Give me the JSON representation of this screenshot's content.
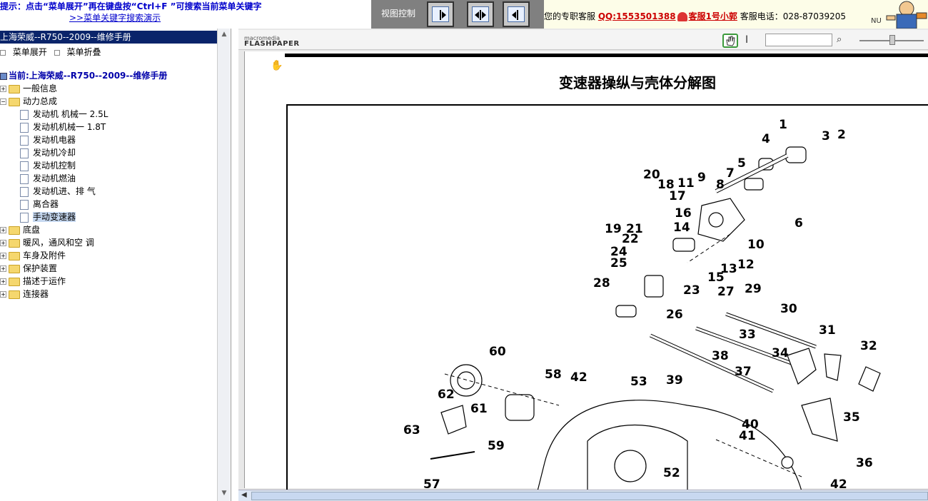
{
  "banner": {
    "hint_line1": "提示：点击“菜单展开”再在键盘按“Ctrl+F ”可搜索当前菜单关键字",
    "hint_line2": ">>菜单关键字搜索演示",
    "view_control_label": "视图控制",
    "support_prefix": "您的专职客服",
    "qq": "QQ:1553501388",
    "kefu": "客服1号小郭",
    "phone_label": "客服电话：028-87039205",
    "nu": "NU"
  },
  "sidebar": {
    "title": "上海荣威--R750--2009--维修手册",
    "expand_label": "菜单展开",
    "collapse_label": "菜单折叠",
    "current_label": "当前:上海荣威--R750--2009--维修手册",
    "items": [
      {
        "label": "一般信息",
        "type": "folder",
        "expanded": false
      },
      {
        "label": "动力总成",
        "type": "folder",
        "expanded": true
      },
      {
        "label": "发动机 机械一 2.5L",
        "type": "doc"
      },
      {
        "label": "发动机机械一 1.8T",
        "type": "doc"
      },
      {
        "label": "发动机电器",
        "type": "doc"
      },
      {
        "label": "发动机冷却",
        "type": "doc"
      },
      {
        "label": "发动机控制",
        "type": "doc"
      },
      {
        "label": "发动机燃油",
        "type": "doc"
      },
      {
        "label": "发动机进、排 气",
        "type": "doc"
      },
      {
        "label": "离合器",
        "type": "doc"
      },
      {
        "label": "手动变速器",
        "type": "doc",
        "selected": true
      },
      {
        "label": "底盘",
        "type": "folder",
        "expanded": false
      },
      {
        "label": "暖风，通风和空 调",
        "type": "folder",
        "expanded": false
      },
      {
        "label": "车身及附件",
        "type": "folder",
        "expanded": false
      },
      {
        "label": "保护装置",
        "type": "folder",
        "expanded": false
      },
      {
        "label": "描述于运作",
        "type": "folder",
        "expanded": false
      },
      {
        "label": "连接器",
        "type": "folder",
        "expanded": false
      }
    ]
  },
  "viewer": {
    "logo_top": "macromedia",
    "logo_bottom": "FLASHPAPER",
    "search_value": "",
    "page_title": "变速器操纵与壳体分解图",
    "callouts": [
      "1",
      "2",
      "3",
      "4",
      "5",
      "6",
      "7",
      "8",
      "9",
      "10",
      "11",
      "12",
      "13",
      "14",
      "15",
      "16",
      "17",
      "18",
      "19",
      "20",
      "21",
      "22",
      "23",
      "24",
      "25",
      "26",
      "27",
      "28",
      "29",
      "30",
      "31",
      "32",
      "33",
      "34",
      "35",
      "36",
      "37",
      "38",
      "39",
      "40",
      "41",
      "42",
      "52",
      "53",
      "57",
      "58",
      "59",
      "60",
      "61",
      "62",
      "63"
    ]
  },
  "colors": {
    "sidebar_title_bg": "#0a246a",
    "hint_text": "#0000cc",
    "view_panel_bg": "#808080",
    "support_red": "#cc0000",
    "hand_tool_border": "#3c9a3c"
  }
}
